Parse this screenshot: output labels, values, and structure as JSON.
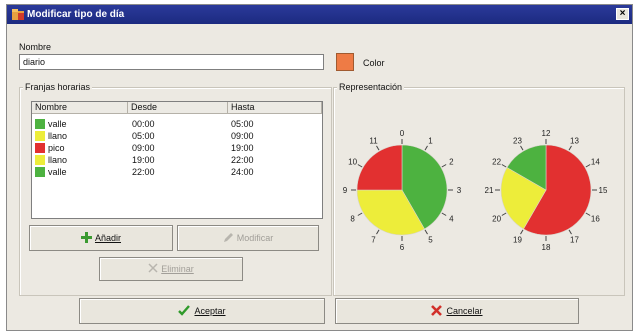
{
  "window": {
    "title": "Modificar tipo de día",
    "close": "×"
  },
  "nombre": {
    "label": "Nombre",
    "value": "diario"
  },
  "color": {
    "label": "Color",
    "value": "#ee7b45"
  },
  "franjas": {
    "label": "Franjas horarias",
    "columns": [
      "Nombre",
      "Desde",
      "Hasta"
    ],
    "rows": [
      {
        "nombre": "valle",
        "desde": "00:00",
        "hasta": "05:00",
        "color": "#4db240"
      },
      {
        "nombre": "llano",
        "desde": "05:00",
        "hasta": "09:00",
        "color": "#eded3a"
      },
      {
        "nombre": "pico",
        "desde": "09:00",
        "hasta": "19:00",
        "color": "#e23030"
      },
      {
        "nombre": "llano",
        "desde": "19:00",
        "hasta": "22:00",
        "color": "#eded3a"
      },
      {
        "nombre": "valle",
        "desde": "22:00",
        "hasta": "24:00",
        "color": "#4db240"
      }
    ]
  },
  "buttons": {
    "add": "Añadir",
    "modify": "Modificar",
    "delete": "Eliminar",
    "accept": "Aceptar",
    "cancel": "Cancelar"
  },
  "representacion": {
    "label": "Representación",
    "clock1_labels": [
      "0",
      "1",
      "2",
      "3",
      "4",
      "5",
      "6",
      "7",
      "8",
      "9",
      "10",
      "11"
    ],
    "clock2_labels": [
      "12",
      "13",
      "14",
      "15",
      "16",
      "17",
      "18",
      "19",
      "20",
      "21",
      "22",
      "23"
    ]
  }
}
